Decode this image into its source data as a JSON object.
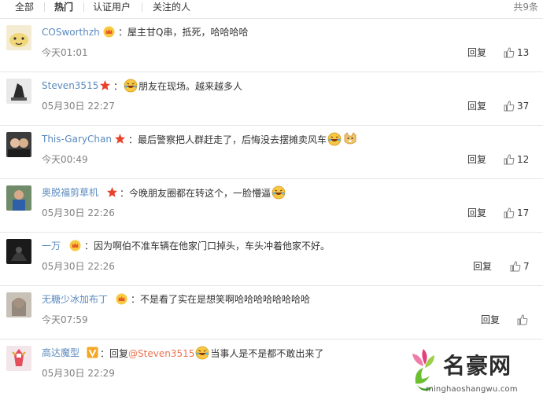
{
  "tabs": [
    {
      "label": "全部"
    },
    {
      "label": "热门"
    },
    {
      "label": "认证用户"
    },
    {
      "label": "关注的人"
    }
  ],
  "total_count": "共9条",
  "reply_label": "回复",
  "comments": [
    {
      "user": "COSworthzh",
      "badge": "crown-icon",
      "text": "：屋主甘Q串，抵死，哈哈哈哈",
      "time": "今天01:01",
      "likes": "13"
    },
    {
      "user": "Steven3515",
      "badge": "red-star-icon",
      "text": "：",
      "text2": "朋友在现场。越来越多人",
      "time": "05月30日 22:27",
      "likes": "37"
    },
    {
      "user": "This-GaryChan",
      "badge": "red-star-icon",
      "text": "：最后警察把人群赶走了，后悔没去摆摊卖风车",
      "time": "今天00:49",
      "likes": "12"
    },
    {
      "user": "奥脱福剪草机",
      "badge": "red-star-icon",
      "text": "：今晚朋友圈都在转这个，一脸懵逼",
      "time": "05月30日 22:26",
      "likes": "17"
    },
    {
      "user": "一万",
      "badge": "crown-icon",
      "text": "：因为啊伯不准车辆在他家门口掉头，车头冲着他家不好。",
      "time": "05月30日 22:26",
      "likes": "7"
    },
    {
      "user": "无糖少冰加布丁",
      "badge": "crown-icon",
      "text": "：不是看了实在是想笑啊哈哈哈哈哈哈哈哈",
      "time": "今天07:59",
      "likes": ""
    },
    {
      "user": "高达魔型",
      "badge": "orange-v-icon",
      "text": "：回复",
      "mention": "@Steven3515",
      "text2": "当事人是不是都不敢出来了",
      "time": "05月30日 22:29",
      "likes": ""
    }
  ],
  "watermark": {
    "title": "名豪网",
    "url": "minghaoshangwu.com"
  }
}
